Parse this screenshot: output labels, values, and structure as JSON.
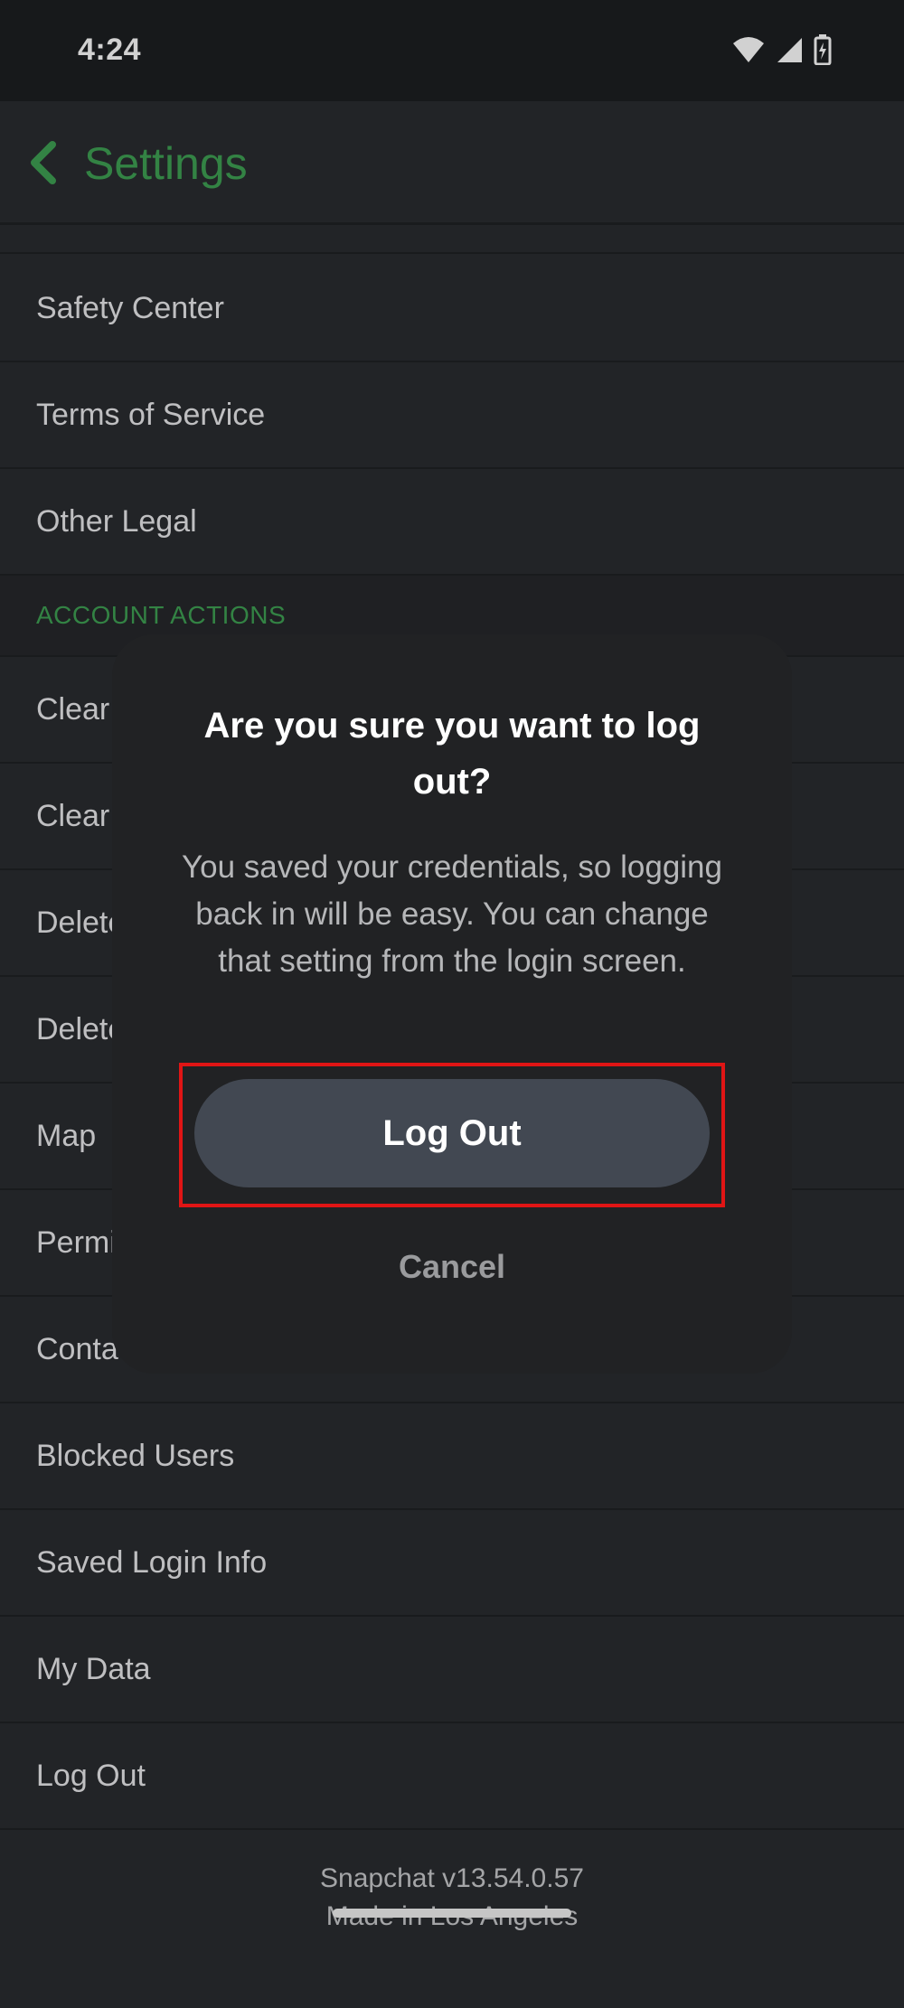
{
  "status_bar": {
    "time": "4:24",
    "icons": [
      "wifi-icon",
      "signal-icon",
      "battery-charging-icon"
    ]
  },
  "header": {
    "title": "Settings",
    "back_icon": "chevron-left-icon",
    "accent_color": "#3fa053"
  },
  "list": {
    "top_items": [
      "Safety Center",
      "Terms of Service",
      "Other Legal"
    ],
    "section_label": "ACCOUNT ACTIONS",
    "account_items": [
      "Clear Conversations",
      "Clear Search History",
      "Delete",
      "Delete",
      "Map",
      "Permissions",
      "Contact Syncing",
      "Blocked Users",
      "Saved Login Info",
      "My Data",
      "Log Out"
    ]
  },
  "footer": {
    "version": "Snapchat v13.54.0.57",
    "made_in": "Made in Los Angeles"
  },
  "dialog": {
    "title": "Are you sure you want to log out?",
    "message": "You saved your credentials, so logging back in will be easy. You can change that setting from the login screen.",
    "confirm_label": "Log Out",
    "cancel_label": "Cancel"
  }
}
